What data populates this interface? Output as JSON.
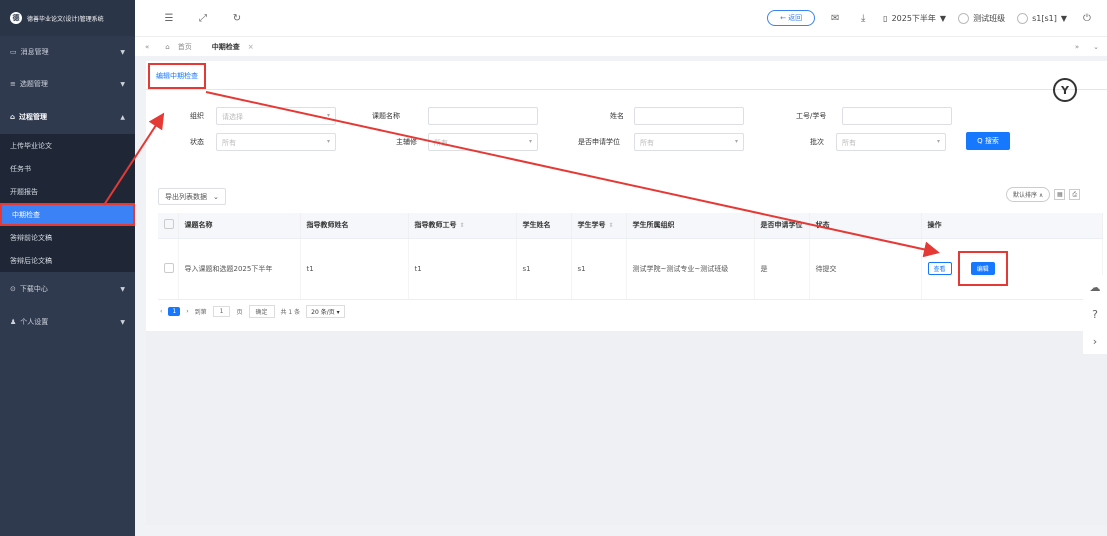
{
  "app": {
    "title": "德善毕业论文(设计)管理系统"
  },
  "sidebar": {
    "items": [
      {
        "label": "消息管理"
      },
      {
        "label": "选题管理"
      },
      {
        "label": "过程管理"
      },
      {
        "label": "下载中心"
      },
      {
        "label": "个人设置"
      }
    ],
    "sub_items": [
      {
        "label": "上传毕业论文"
      },
      {
        "label": "任务书"
      },
      {
        "label": "开题报告"
      },
      {
        "label": "中期检查"
      },
      {
        "label": "答辩前论文稿"
      },
      {
        "label": "答辩后论文稿"
      }
    ]
  },
  "topbar": {
    "back_label": "← 返回",
    "semester": "2025下半年",
    "class": "测试班级",
    "user": "s1[s1]"
  },
  "tabs": {
    "home": "首页",
    "current": "中期检查"
  },
  "page": {
    "tab_label": "编辑中期检查",
    "badge": "Y"
  },
  "filters": {
    "org_label": "组织",
    "org_placeholder": "请选择",
    "title_label": "课题名称",
    "name_label": "姓名",
    "id_label": "工号/学号",
    "status_label": "状态",
    "status_value": "所有",
    "advisor_label": "主辅修",
    "advisor_value": "所有",
    "degree_label": "是否申请学位",
    "degree_value": "所有",
    "batch_label": "批次",
    "batch_value": "所有",
    "search_label": "Q 搜索"
  },
  "toolbar": {
    "export_label": "导出列表数据",
    "sort_label": "默认排序 ∧"
  },
  "table": {
    "headers": [
      "课题名称",
      "指导教师姓名",
      "指导教师工号",
      "学生姓名",
      "学生学号",
      "学生所属组织",
      "是否申请学位",
      "状态",
      "操作"
    ],
    "rows": [
      {
        "title": "导入课题和选题2025下半年",
        "teacher": "t1",
        "teacher_id": "t1",
        "student": "s1",
        "student_id": "s1",
        "org": "测试学院~测试专业~测试班级",
        "degree": "是",
        "status": "待提交",
        "view": "查看",
        "edit": "编辑"
      }
    ]
  },
  "pager": {
    "page": "1",
    "goto_label": "到第",
    "goto_value": "1",
    "page_unit": "页",
    "confirm": "确定",
    "total": "共 1 条",
    "per_page": "20 条/页"
  },
  "colors": {
    "accent": "#1677ff",
    "highlight": "#e53935",
    "sidebar": "#2f3a4f"
  }
}
